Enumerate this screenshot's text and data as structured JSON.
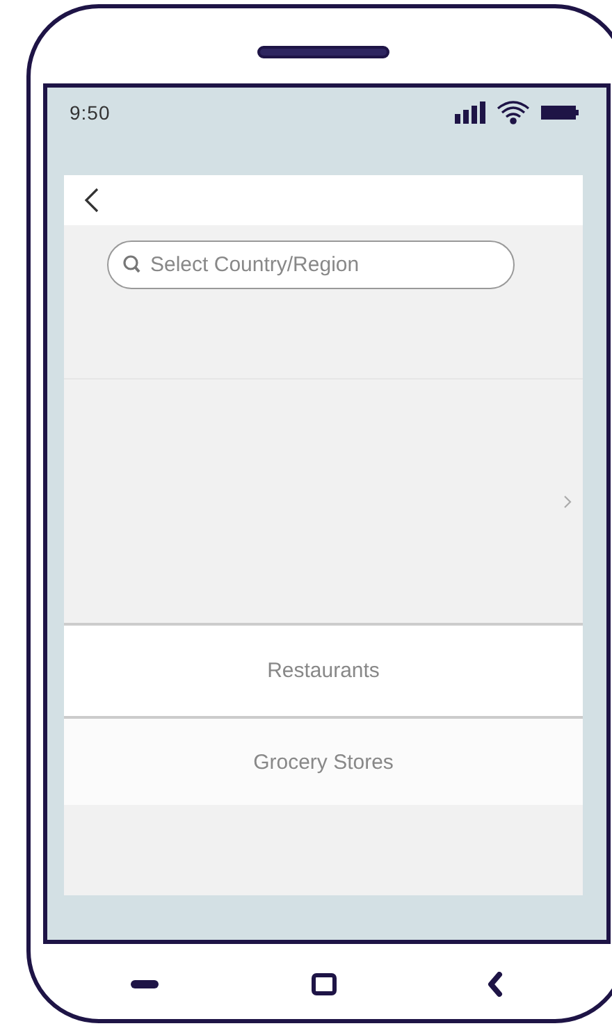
{
  "status_bar": {
    "time": "9:50"
  },
  "search": {
    "placeholder": "Select Country/Region"
  },
  "list": [
    {
      "label": "Restaurants"
    },
    {
      "label": "Grocery Stores"
    }
  ]
}
